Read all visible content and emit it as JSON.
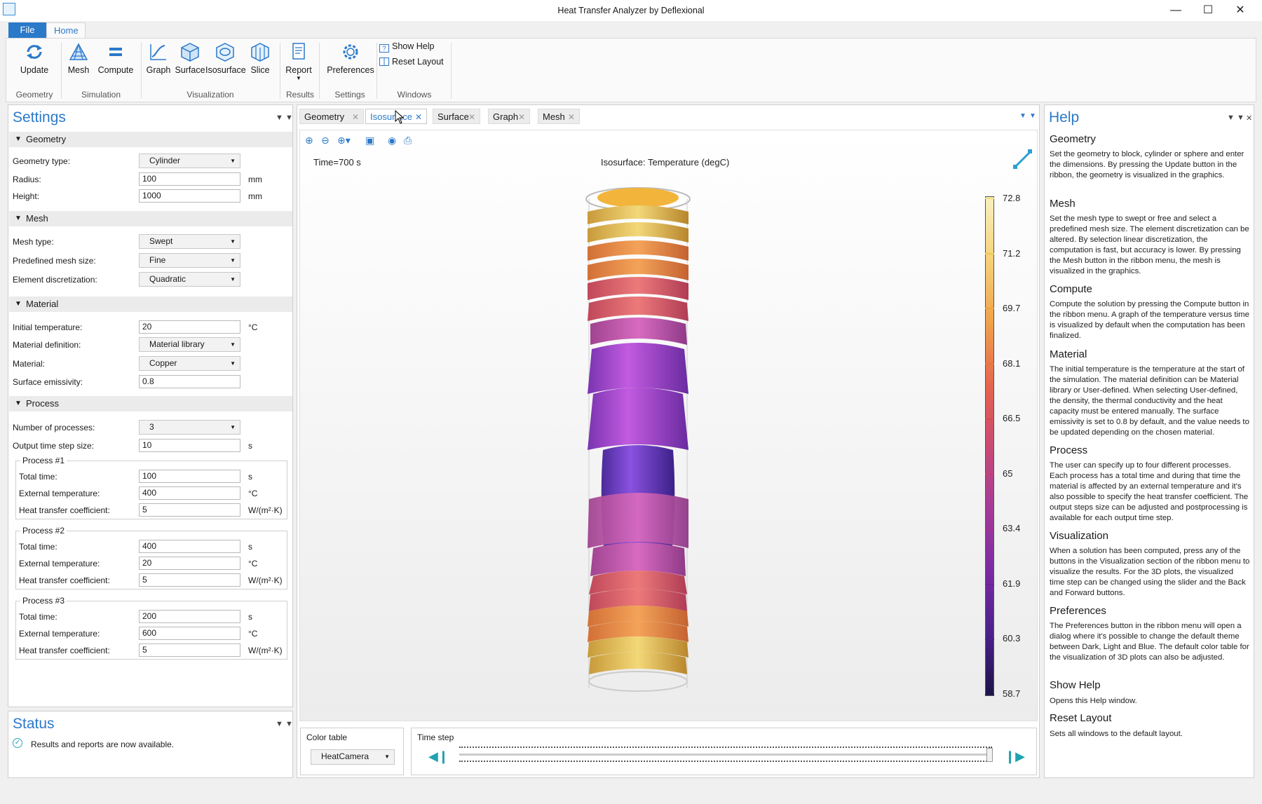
{
  "window": {
    "title": "Heat Transfer Analyzer by Deflexional"
  },
  "ribbon": {
    "tabs": [
      "File",
      "Home"
    ],
    "buttons": {
      "update": "Update",
      "mesh": "Mesh",
      "compute": "Compute",
      "graph": "Graph",
      "surface": "Surface",
      "isosurface": "Isosurface",
      "slice": "Slice",
      "report": "Report",
      "preferences": "Preferences",
      "show_help": "Show Help",
      "reset_layout": "Reset Layout"
    },
    "groups": {
      "geometry": "Geometry",
      "simulation": "Simulation",
      "visualization": "Visualization",
      "results": "Results",
      "settings": "Settings",
      "windows": "Windows"
    }
  },
  "settings": {
    "title": "Settings",
    "geometry": {
      "header": "Geometry",
      "type_label": "Geometry type:",
      "type_value": "Cylinder",
      "radius_label": "Radius:",
      "radius_value": "100",
      "radius_unit": "mm",
      "height_label": "Height:",
      "height_value": "1000",
      "height_unit": "mm"
    },
    "mesh": {
      "header": "Mesh",
      "type_label": "Mesh type:",
      "type_value": "Swept",
      "size_label": "Predefined mesh size:",
      "size_value": "Fine",
      "disc_label": "Element discretization:",
      "disc_value": "Quadratic"
    },
    "material": {
      "header": "Material",
      "init_temp_label": "Initial temperature:",
      "init_temp_value": "20",
      "init_temp_unit": "°C",
      "def_label": "Material definition:",
      "def_value": "Material library",
      "material_label": "Material:",
      "material_value": "Copper",
      "emis_label": "Surface emissivity:",
      "emis_value": "0.8"
    },
    "process": {
      "header": "Process",
      "num_label": "Number of processes:",
      "num_value": "3",
      "step_label": "Output time step size:",
      "step_value": "10",
      "step_unit": "s",
      "total_time_label": "Total time:",
      "ext_temp_label": "External temperature:",
      "htc_label": "Heat transfer coefficient:",
      "unit_s": "s",
      "unit_c": "°C",
      "unit_htc": "W/(m²·K)",
      "processes": [
        {
          "name": "Process #1",
          "total_time": "100",
          "ext_temp": "400",
          "htc": "5"
        },
        {
          "name": "Process #2",
          "total_time": "400",
          "ext_temp": "20",
          "htc": "5"
        },
        {
          "name": "Process #3",
          "total_time": "200",
          "ext_temp": "600",
          "htc": "5"
        }
      ]
    }
  },
  "status": {
    "title": "Status",
    "message": "Results and reports are now available."
  },
  "doc_tabs": [
    "Geometry",
    "Isosurface",
    "Surface",
    "Graph",
    "Mesh"
  ],
  "graphics": {
    "time_label": "Time=700 s",
    "plot_title": "Isosurface: Temperature (degC)",
    "legend": [
      "72.8",
      "71.2",
      "69.7",
      "68.1",
      "66.5",
      "65",
      "63.4",
      "61.9",
      "60.3",
      "58.7"
    ],
    "legend_tick_colors": [
      "#f3e07a",
      "#f2c94e",
      "#f0a03a",
      "#e8703b",
      "#d94a4f",
      "#c93b6f",
      "#9f2f93",
      "#6a23a0",
      "#45208f",
      "#201656"
    ]
  },
  "color_table": {
    "label": "Color table",
    "value": "HeatCamera"
  },
  "time_step": {
    "label": "Time step"
  },
  "help": {
    "title": "Help",
    "sections": [
      {
        "head": "Geometry",
        "text": "Set the geometry to block, cylinder or sphere and enter the dimensions. By pressing the Update button in the ribbon, the geometry is visualized in the graphics."
      },
      {
        "head": "Mesh",
        "text": "Set the mesh type to swept or free and select a predefined mesh size.  The element discretization can be altered. By selection linear discretization, the computation is fast, but accuracy is lower.  By pressing the Mesh button in the ribbon menu, the mesh is visualized in the graphics."
      },
      {
        "head": "Compute",
        "text": "Compute the solution by pressing the Compute button in the ribbon menu. A graph of the temperature versus time is visualized by default when the computation has been finalized."
      },
      {
        "head": "Material",
        "text": "The initial temperature is the temperature at the start of the simulation. The material definition can be Material library or User-defined. When selecting User-defined, the density, the thermal conductivity and the heat capacity must be entered manually. The surface emissivity is set to 0.8 by default, and the value needs to be updated depending on the chosen material."
      },
      {
        "head": "Process",
        "text": "The user can specify up to four different processes. Each process has a total time and during that time the material is affected by an external temperature and it's also possible to specify the heat transfer coefficient. The output steps size can be adjusted and postprocessing is available for each output time step."
      },
      {
        "head": "Visualization",
        "text": "When a solution has been computed, press any of the buttons in the Visualization section of the ribbon menu to visualize the results. For the 3D plots, the visualized time step can be changed using the slider and the Back and Forward buttons."
      },
      {
        "head": "Preferences",
        "text": "The Preferences button in the ribbon menu will open a dialog where it's possible to change the default theme between Dark, Light and Blue. The default color table for the visualization of 3D plots can also be adjusted."
      },
      {
        "head": "Show Help",
        "text": "Opens this Help window."
      },
      {
        "head": "Reset Layout",
        "text": "Sets all windows to the default layout."
      }
    ]
  }
}
